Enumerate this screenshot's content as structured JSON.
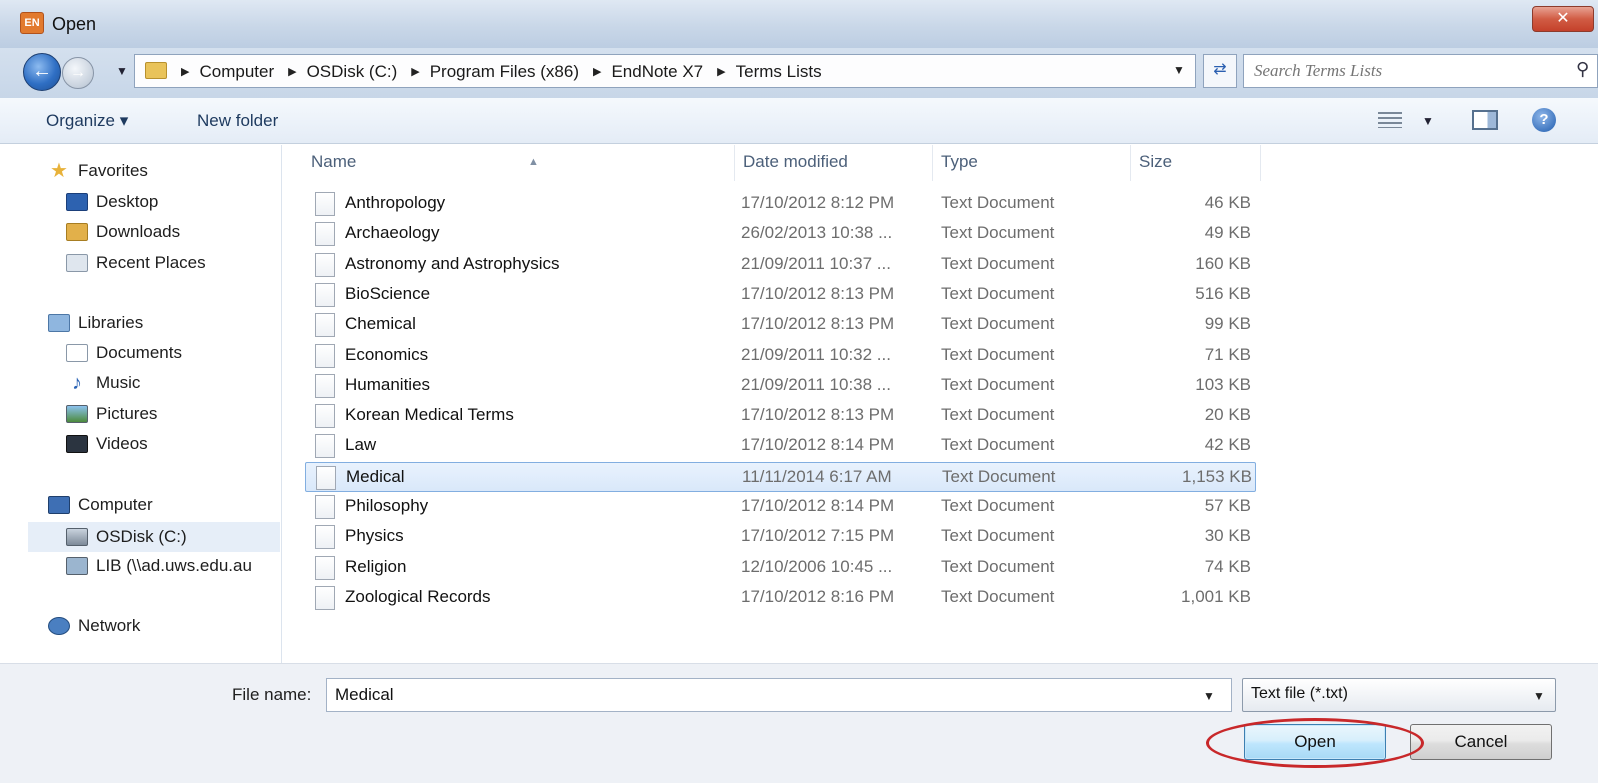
{
  "window": {
    "title": "Open",
    "app_icon_text": "EN",
    "close_glyph": "✕"
  },
  "address": {
    "breadcrumbs": [
      "Computer",
      "OSDisk (C:)",
      "Program Files (x86)",
      "EndNote X7",
      "Terms Lists"
    ],
    "search_placeholder": "Search Terms Lists"
  },
  "toolbar": {
    "organize_label": "Organize ▾",
    "new_folder_label": "New folder"
  },
  "sidebar": {
    "favorites_label": "Favorites",
    "favorites": [
      "Desktop",
      "Downloads",
      "Recent Places"
    ],
    "libraries_label": "Libraries",
    "libraries": [
      "Documents",
      "Music",
      "Pictures",
      "Videos"
    ],
    "computer_label": "Computer",
    "computer": [
      "OSDisk (C:)",
      "LIB (\\\\ad.uws.edu.au"
    ],
    "network_label": "Network"
  },
  "columns": {
    "name": "Name",
    "date": "Date modified",
    "type": "Type",
    "size": "Size"
  },
  "files": [
    {
      "name": "Anthropology",
      "date": "17/10/2012 8:12 PM",
      "type": "Text Document",
      "size": "46 KB"
    },
    {
      "name": "Archaeology",
      "date": "26/02/2013 10:38 ...",
      "type": "Text Document",
      "size": "49 KB"
    },
    {
      "name": "Astronomy and Astrophysics",
      "date": "21/09/2011 10:37 ...",
      "type": "Text Document",
      "size": "160 KB"
    },
    {
      "name": "BioScience",
      "date": "17/10/2012 8:13 PM",
      "type": "Text Document",
      "size": "516 KB"
    },
    {
      "name": "Chemical",
      "date": "17/10/2012 8:13 PM",
      "type": "Text Document",
      "size": "99 KB"
    },
    {
      "name": "Economics",
      "date": "21/09/2011 10:32 ...",
      "type": "Text Document",
      "size": "71 KB"
    },
    {
      "name": "Humanities",
      "date": "21/09/2011 10:38 ...",
      "type": "Text Document",
      "size": "103 KB"
    },
    {
      "name": "Korean Medical Terms",
      "date": "17/10/2012 8:13 PM",
      "type": "Text Document",
      "size": "20 KB"
    },
    {
      "name": "Law",
      "date": "17/10/2012 8:14 PM",
      "type": "Text Document",
      "size": "42 KB"
    },
    {
      "name": "Medical",
      "date": "11/11/2014 6:17 AM",
      "type": "Text Document",
      "size": "1,153 KB"
    },
    {
      "name": "Philosophy",
      "date": "17/10/2012 8:14 PM",
      "type": "Text Document",
      "size": "57 KB"
    },
    {
      "name": "Physics",
      "date": "17/10/2012 7:15 PM",
      "type": "Text Document",
      "size": "30 KB"
    },
    {
      "name": "Religion",
      "date": "12/10/2006 10:45 ...",
      "type": "Text Document",
      "size": "74 KB"
    },
    {
      "name": "Zoological Records",
      "date": "17/10/2012 8:16 PM",
      "type": "Text Document",
      "size": "1,001 KB"
    }
  ],
  "selected_file_index": 9,
  "footer": {
    "file_name_label": "File name:",
    "file_name_value": "Medical",
    "file_type_value": "Text file  (*.txt)",
    "open_label": "Open",
    "cancel_label": "Cancel"
  },
  "colors": {
    "annotation": "#c8282a",
    "selection": "#d9e8fa"
  }
}
